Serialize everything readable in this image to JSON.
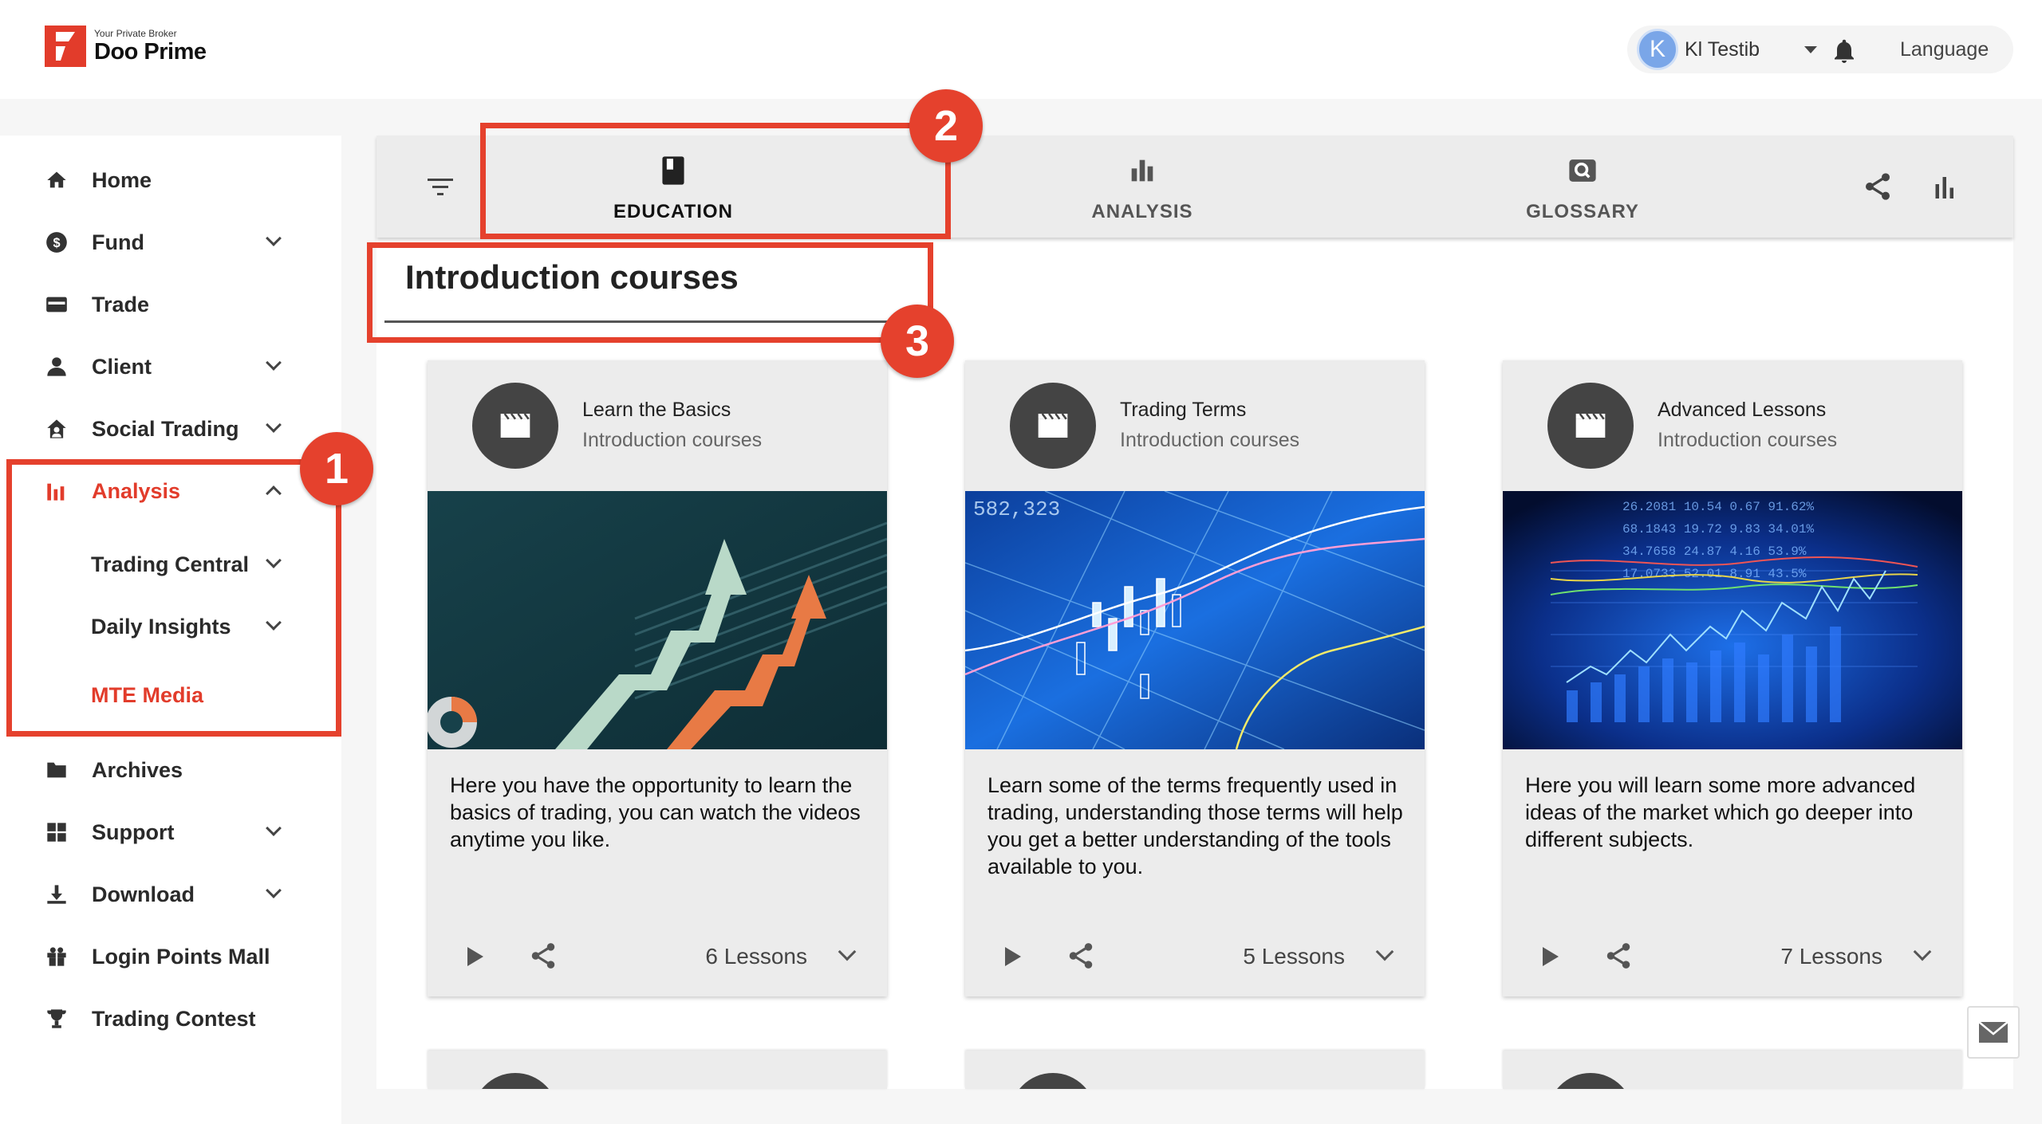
{
  "header": {
    "logo_tagline": "Your Private Broker",
    "logo_name": "Doo Prime",
    "user_initial": "K",
    "user_name": "Kl Testib",
    "language_label": "Language"
  },
  "sidebar": {
    "items": [
      {
        "label": "Home",
        "icon": "home-icon"
      },
      {
        "label": "Fund",
        "icon": "dollar-icon"
      },
      {
        "label": "Trade",
        "icon": "card-icon"
      },
      {
        "label": "Client",
        "icon": "person-icon"
      },
      {
        "label": "Social Trading",
        "icon": "social-home-icon"
      },
      {
        "label": "Analysis",
        "icon": "bar-chart-icon"
      },
      {
        "label": "Archives",
        "icon": "folder-icon"
      },
      {
        "label": "Support",
        "icon": "grid-icon"
      },
      {
        "label": "Download",
        "icon": "download-icon"
      },
      {
        "label": "Login Points Mall",
        "icon": "gift-icon"
      },
      {
        "label": "Trading Contest",
        "icon": "trophy-icon"
      }
    ],
    "analysis_sub": [
      {
        "label": "Trading Central"
      },
      {
        "label": "Daily Insights"
      },
      {
        "label": "MTE Media"
      }
    ]
  },
  "tabs": [
    {
      "label": "EDUCATION",
      "icon": "book-icon",
      "active": true
    },
    {
      "label": "ANALYSIS",
      "icon": "bar-chart-icon",
      "active": false
    },
    {
      "label": "GLOSSARY",
      "icon": "search-icon",
      "active": false
    }
  ],
  "section": {
    "title": "Introduction courses"
  },
  "cards": [
    {
      "title": "Learn the Basics",
      "subtitle": "Introduction courses",
      "description": "Here you have the opportunity to learn the basics of trading, you can watch the videos anytime you like.",
      "lessons": "6 Lessons"
    },
    {
      "title": "Trading Terms",
      "subtitle": "Introduction courses",
      "description": "Learn some of the terms frequently used in trading, understanding those terms will help you get a better understanding of the tools available to you.",
      "lessons": "5 Lessons"
    },
    {
      "title": "Advanced Lessons",
      "subtitle": "Introduction courses",
      "description": "Here you will learn some more advanced ideas of the market which go deeper into different subjects.",
      "lessons": "7 Lessons"
    }
  ],
  "annotations": {
    "badge1": "1",
    "badge2": "2",
    "badge3": "3"
  },
  "colors": {
    "accent": "#e23c2b",
    "annotation": "#e5412d",
    "card_bg": "#ececec"
  }
}
